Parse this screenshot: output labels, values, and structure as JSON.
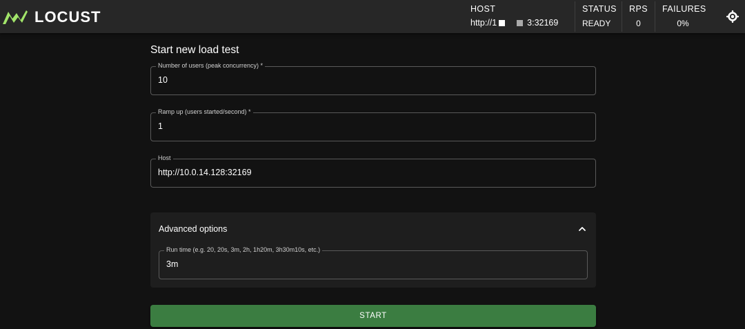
{
  "app": {
    "logo_text": "LOCUST",
    "accent_color": "#a2e56a"
  },
  "header": {
    "host_label": "HOST",
    "host_value_prefix": "http://1",
    "host_value_suffix": "3:32169",
    "status_label": "STATUS",
    "status_value": "READY",
    "rps_label": "RPS",
    "rps_value": "0",
    "failures_label": "FAILURES",
    "failures_value": "0%"
  },
  "form": {
    "title": "Start new load test",
    "users_label": "Number of users (peak concurrency) *",
    "users_value": "10",
    "ramp_label": "Ramp up (users started/second) *",
    "ramp_value": "1",
    "host_label": "Host",
    "host_value": "http://10.0.14.128:32169",
    "advanced_title": "Advanced options",
    "runtime_label": "Run time (e.g. 20, 20s, 3m, 2h, 1h20m, 3h30m10s, etc.)",
    "runtime_value": "3m",
    "start_label": "START"
  },
  "icons": {
    "logo": "locust-logo-icon",
    "theme": "sun-icon",
    "advanced_toggle": "chevron-up-icon"
  }
}
